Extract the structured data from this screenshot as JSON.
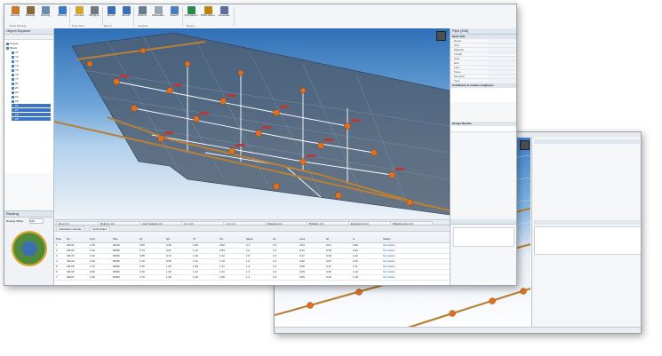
{
  "ribbon": {
    "buttons": [
      {
        "label": "Routing",
        "color": "#c87a2a"
      },
      {
        "label": "Routing",
        "color": "#8a6a3a"
      },
      {
        "label": "Routing",
        "color": "#6a8ab0"
      },
      {
        "label": "Routing",
        "color": "#3b78c4"
      },
      {
        "label": "Connect",
        "color": "#d4a72c"
      },
      {
        "label": "Bridging",
        "color": "#707880"
      },
      {
        "label": "Export",
        "color": "#3a6fb5"
      },
      {
        "label": "Export",
        "color": "#3a6fb5"
      },
      {
        "label": "Options",
        "color": "#6a7a8a"
      },
      {
        "label": "Baseplate",
        "color": "#9aa7b3"
      },
      {
        "label": "Search",
        "color": "#4a7fbf"
      },
      {
        "label": "Clip Report",
        "color": "#2a8a4a"
      },
      {
        "label": "BOM Report",
        "color": "#b8860b"
      },
      {
        "label": "Generate",
        "color": "#5a6ea0"
      }
    ],
    "groups": [
      "Draw Routing",
      "Draw Item",
      "Export",
      "Analysis",
      "Report"
    ]
  },
  "explorer": {
    "title": "Object Explorer",
    "items": [
      "Project",
      "[Root]",
      "Y1",
      "Y2",
      "Y3",
      "Y4",
      "Y5",
      "Y6",
      "Y7",
      "Z1",
      "Z2",
      "Z3",
      "Z4",
      "Z5",
      "Z6",
      "Z7",
      "Z8",
      "Z9"
    ]
  },
  "routing": {
    "title": "Routing",
    "spacing_label": "Routing Offset",
    "spacing_value": "100"
  },
  "properties": {
    "title": "Pipe [333]",
    "section1": "Basic Info.",
    "section2": "Coefficient of surface roughness",
    "section3": "Design Results",
    "labels": [
      "Name",
      "Size",
      "Material",
      "Length",
      "Start",
      "End",
      "Flow",
      "Slope",
      "Elevation",
      "Type"
    ]
  },
  "bottom_tabs": [
    "Drop (m)",
    "Delivery (m)",
    "Auto Spacing (m)",
    "L.A. (m)",
    "L.A. (m)",
    "Distance (m)",
    "Bridging (m)",
    "Equipment (m)",
    "Bridging Area (m)"
  ],
  "results": {
    "tabs": [
      "Calculation Results",
      "Optimization"
    ],
    "columns": [
      "Pipe",
      "No.",
      "L(m)",
      "Size",
      "Qf",
      "Qd",
      "Vf",
      "Vd",
      "Slope",
      "Ks",
      "Loss",
      "Hf",
      "H",
      "Status"
    ],
    "rows": [
      [
        "1",
        "CB-01",
        "1.25",
        "DN40",
        "0.52",
        "0.40",
        "1.05",
        "0.82",
        "2.1",
        "1.5",
        "0.34",
        "0.21",
        "0.90",
        "Normative"
      ],
      [
        "2",
        "CB-02",
        "2.40",
        "DN50",
        "0.74",
        "0.61",
        "1.12",
        "0.93",
        "2.0",
        "1.5",
        "0.41",
        "0.28",
        "0.93",
        "Normative"
      ],
      [
        "3",
        "CB-03",
        "3.10",
        "DN50",
        "0.88",
        "0.72",
        "1.20",
        "1.02",
        "1.8",
        "1.5",
        "0.47",
        "0.33",
        "1.02",
        "Normative"
      ],
      [
        "4",
        "CB-04",
        "1.90",
        "DN65",
        "1.10",
        "0.95",
        "1.31",
        "1.10",
        "1.6",
        "1.5",
        "0.52",
        "0.37",
        "1.06",
        "Normative"
      ],
      [
        "5",
        "CB-05",
        "2.75",
        "DN65",
        "1.25",
        "1.04",
        "1.38",
        "1.17",
        "1.5",
        "1.5",
        "0.58",
        "0.41",
        "1.11",
        "Normative"
      ],
      [
        "6",
        "CB-06",
        "0.95",
        "DN80",
        "1.52",
        "1.30",
        "1.44",
        "1.21",
        "1.4",
        "1.5",
        "0.63",
        "0.45",
        "1.14",
        "Normative"
      ],
      [
        "7",
        "CB-07",
        "1.60",
        "DN80",
        "1.70",
        "1.46",
        "1.49",
        "1.28",
        "1.3",
        "1.5",
        "0.69",
        "0.49",
        "1.18",
        "Normative"
      ]
    ]
  },
  "colors": {
    "pipe": "#e07020",
    "plate": "#4d5e72",
    "bar": "#b87f36",
    "selection": "#3a74c2"
  }
}
